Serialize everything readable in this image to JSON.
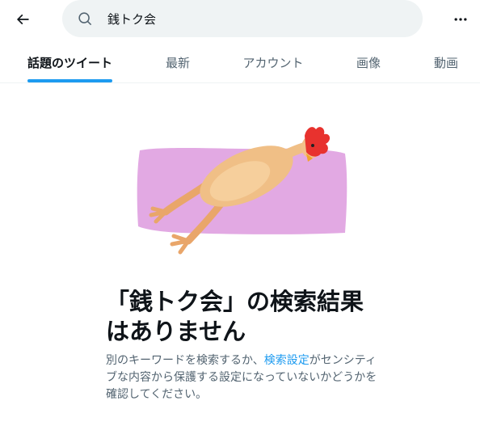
{
  "topbar": {
    "back_icon": "arrow-left-icon",
    "search": {
      "icon": "search-icon",
      "value": "銭トク会",
      "placeholder": ""
    },
    "more_icon": "more-horizontal-icon"
  },
  "tabs": [
    {
      "label": "話題のツイート",
      "active": true
    },
    {
      "label": "最新",
      "active": false
    },
    {
      "label": "アカウント",
      "active": false
    },
    {
      "label": "画像",
      "active": false
    },
    {
      "label": "動画",
      "active": false
    }
  ],
  "colors": {
    "accent": "#1d9bf0",
    "text_primary": "#0f1419",
    "text_secondary": "#536471",
    "search_bg": "#eff3f4",
    "illustration_bg": "#e2a9e3"
  },
  "empty_state": {
    "illustration": "rubber-chicken-illustration",
    "title": "「銭トク会」の検索結果はありません",
    "desc_before": "別のキーワードを検索するか、",
    "desc_link": "検索設定",
    "desc_after": "がセンシティブな内容から保護する設定になっていないかどうかを確認してください。"
  }
}
